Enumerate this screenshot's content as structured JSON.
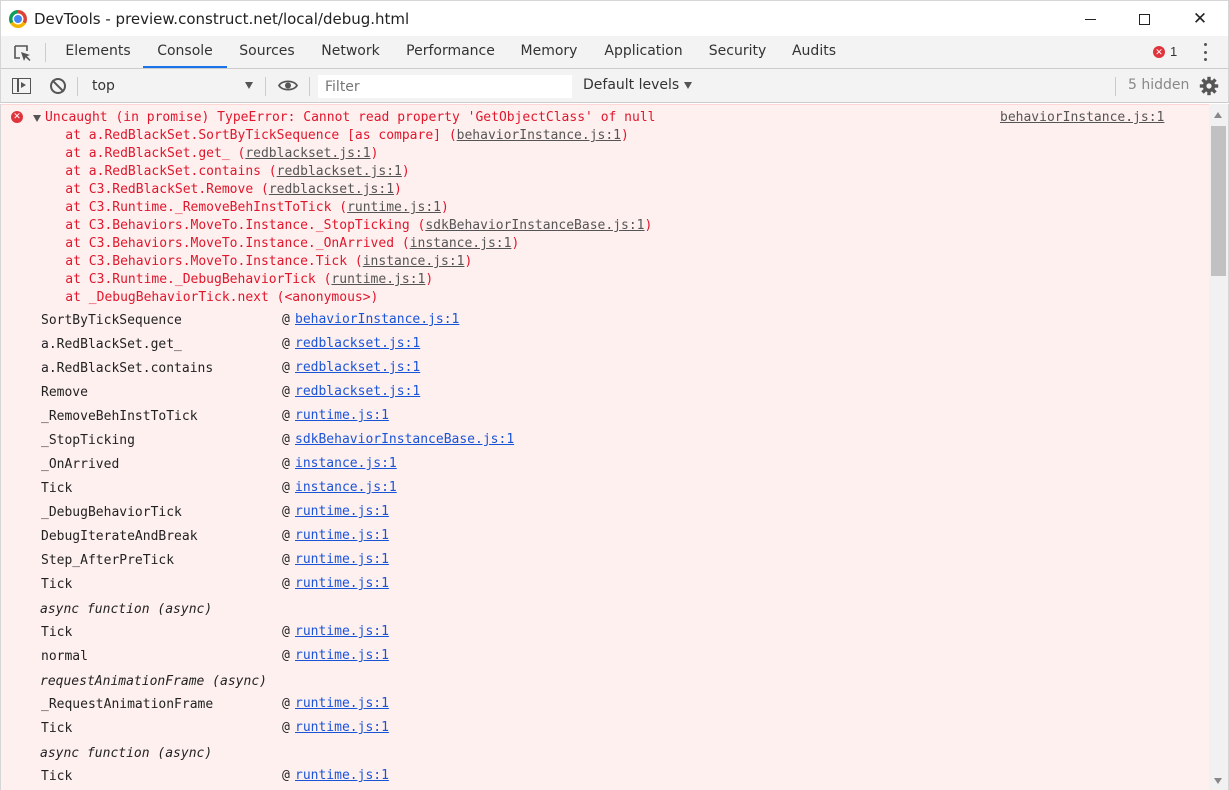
{
  "window": {
    "title": "DevTools - preview.construct.net/local/debug.html",
    "minimize_icon": "minimize-icon",
    "maximize_icon": "maximize-icon",
    "close_glyph": "✕"
  },
  "tabs": [
    {
      "label": "Elements",
      "active": false
    },
    {
      "label": "Console",
      "active": true
    },
    {
      "label": "Sources",
      "active": false
    },
    {
      "label": "Network",
      "active": false
    },
    {
      "label": "Performance",
      "active": false
    },
    {
      "label": "Memory",
      "active": false
    },
    {
      "label": "Application",
      "active": false
    },
    {
      "label": "Security",
      "active": false
    },
    {
      "label": "Audits",
      "active": false
    }
  ],
  "error_badge": {
    "count": "1",
    "glyph": "✕",
    "color": "#e0343d"
  },
  "toolbar": {
    "context": "top",
    "filter_placeholder": "Filter",
    "levels_label": "Default levels",
    "hidden_label": "5 hidden"
  },
  "error": {
    "message": "Uncaught (in promise) TypeError: Cannot read property 'GetObjectClass' of null",
    "source_link": "behaviorInstance.js:1",
    "trace": [
      {
        "text": "    at a.RedBlackSet.SortByTickSequence [as compare] (",
        "link": "behaviorInstance.js:1",
        "end": ")"
      },
      {
        "text": "    at a.RedBlackSet.get_ (",
        "link": "redblackset.js:1",
        "end": ")"
      },
      {
        "text": "    at a.RedBlackSet.contains (",
        "link": "redblackset.js:1",
        "end": ")"
      },
      {
        "text": "    at C3.RedBlackSet.Remove (",
        "link": "redblackset.js:1",
        "end": ")"
      },
      {
        "text": "    at C3.Runtime._RemoveBehInstToTick (",
        "link": "runtime.js:1",
        "end": ")"
      },
      {
        "text": "    at C3.Behaviors.MoveTo.Instance._StopTicking (",
        "link": "sdkBehaviorInstanceBase.js:1",
        "end": ")"
      },
      {
        "text": "    at C3.Behaviors.MoveTo.Instance._OnArrived (",
        "link": "instance.js:1",
        "end": ")"
      },
      {
        "text": "    at C3.Behaviors.MoveTo.Instance.Tick (",
        "link": "instance.js:1",
        "end": ")"
      },
      {
        "text": "    at C3.Runtime._DebugBehaviorTick (",
        "link": "runtime.js:1",
        "end": ")"
      },
      {
        "text": "    at _DebugBehaviorTick.next (<anonymous>)",
        "link": "",
        "end": ""
      }
    ]
  },
  "stack": [
    {
      "type": "frame",
      "fn": "SortByTickSequence",
      "at": "@",
      "link": "behaviorInstance.js:1"
    },
    {
      "type": "frame",
      "fn": "a.RedBlackSet.get_",
      "at": "@",
      "link": "redblackset.js:1"
    },
    {
      "type": "frame",
      "fn": "a.RedBlackSet.contains",
      "at": "@",
      "link": "redblackset.js:1"
    },
    {
      "type": "frame",
      "fn": "Remove",
      "at": "@",
      "link": "redblackset.js:1"
    },
    {
      "type": "frame",
      "fn": "_RemoveBehInstToTick",
      "at": "@",
      "link": "runtime.js:1"
    },
    {
      "type": "frame",
      "fn": "_StopTicking",
      "at": "@",
      "link": "sdkBehaviorInstanceBase.js:1"
    },
    {
      "type": "frame",
      "fn": "_OnArrived",
      "at": "@",
      "link": "instance.js:1"
    },
    {
      "type": "frame",
      "fn": "Tick",
      "at": "@",
      "link": "instance.js:1"
    },
    {
      "type": "frame",
      "fn": "_DebugBehaviorTick",
      "at": "@",
      "link": "runtime.js:1"
    },
    {
      "type": "frame",
      "fn": "DebugIterateAndBreak",
      "at": "@",
      "link": "runtime.js:1"
    },
    {
      "type": "frame",
      "fn": "Step_AfterPreTick",
      "at": "@",
      "link": "runtime.js:1"
    },
    {
      "type": "frame",
      "fn": "Tick",
      "at": "@",
      "link": "runtime.js:1"
    },
    {
      "type": "async",
      "fn": "async function (async)"
    },
    {
      "type": "frame",
      "fn": "Tick",
      "at": "@",
      "link": "runtime.js:1"
    },
    {
      "type": "frame",
      "fn": "normal",
      "at": "@",
      "link": "runtime.js:1"
    },
    {
      "type": "async",
      "fn": "requestAnimationFrame (async)"
    },
    {
      "type": "frame",
      "fn": "_RequestAnimationFrame",
      "at": "@",
      "link": "runtime.js:1"
    },
    {
      "type": "frame",
      "fn": "Tick",
      "at": "@",
      "link": "runtime.js:1"
    },
    {
      "type": "async",
      "fn": "async function (async)"
    },
    {
      "type": "frame",
      "fn": "Tick",
      "at": "@",
      "link": "runtime.js:1"
    }
  ]
}
